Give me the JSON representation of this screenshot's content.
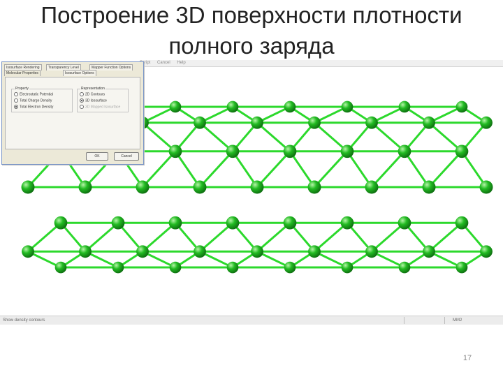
{
  "slide": {
    "title_line1": "Построение 3D поверхности плотности",
    "title_line2": "полного заряда",
    "page_number": "17"
  },
  "app": {
    "menu_items": [
      "Script",
      "Cancel",
      "Help"
    ],
    "status_left": "Show density contours",
    "status_right": "MM2"
  },
  "dialog": {
    "tabs": [
      "Isosurface Rendering",
      "Transparency Level",
      "Mapper Function Options",
      "Molecular Properties",
      "Isosurface Options"
    ],
    "property_group_title": "Property",
    "property_options": [
      "Electrostatic Potential",
      "Total Charge Density",
      "Total Electron Density"
    ],
    "property_selected_index": 2,
    "rendering_group_title": "Representation",
    "rendering_options": [
      "2D Contours",
      "3D Isosurface",
      "3D Mapped Isosurface"
    ],
    "rendering_selected_index": 1,
    "ok_label": "OK",
    "cancel_label": "Cancel"
  },
  "colors": {
    "atom": "#22bb22",
    "atom_highlight": "#b6f5a8",
    "bond": "#2cd92c",
    "dialog_bg": "#ece9d8"
  }
}
